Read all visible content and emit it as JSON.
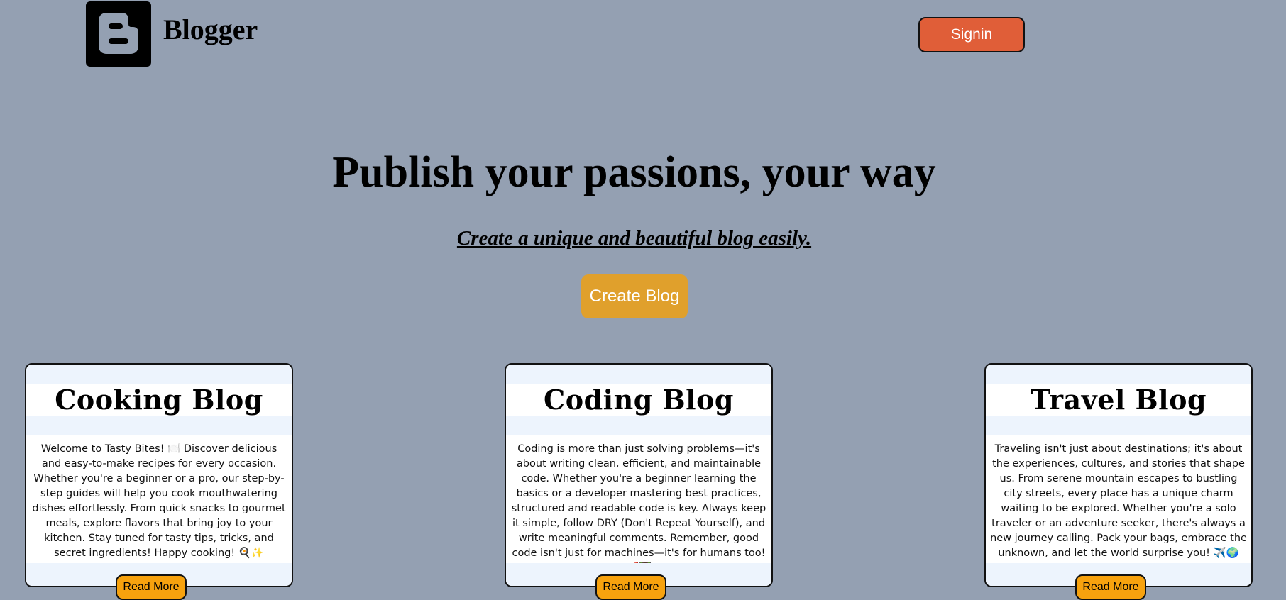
{
  "header": {
    "logo_icon": "blogger-b-icon",
    "brand": "Blogger",
    "signin_label": "Signin"
  },
  "hero": {
    "title": "Publish your passions, your way",
    "subtitle": "Create a unique and beautiful blog easily.",
    "create_label": "Create Blog"
  },
  "colors": {
    "background": "#94a0b2",
    "signin": "#e05e38",
    "create": "#e0a02c",
    "read_more": "#f7a20e",
    "card_band": "#edf4fd"
  },
  "cards": [
    {
      "title": "Cooking Blog",
      "text": "Welcome to Tasty Bites! 🍽️ Discover delicious and easy-to-make recipes for every occasion. Whether you're a beginner or a pro, our step-by-step guides will help you cook mouthwatering dishes effortlessly. From quick snacks to gourmet meals, explore flavors that bring joy to your kitchen. Stay tuned for tasty tips, tricks, and secret ingredients! Happy cooking! 🍳✨",
      "button": "Read More"
    },
    {
      "title": "Coding Blog",
      "text": "Coding is more than just solving problems—it's about writing clean, efficient, and maintainable code. Whether you're a beginner learning the basics or a developer mastering best practices, structured and readable code is key. Always keep it simple, follow DRY (Don't Repeat Yourself), and write meaningful comments. Remember, good code isn't just for machines—it's for humans too! 🚀👨‍💻",
      "button": "Read More"
    },
    {
      "title": "Travel Blog",
      "text": "Traveling isn't just about destinations; it's about the experiences, cultures, and stories that shape us. From serene mountain escapes to bustling city streets, every place has a unique charm waiting to be explored. Whether you're a solo traveler or an adventure seeker, there's always a new journey calling. Pack your bags, embrace the unknown, and let the world surprise you! ✈️🌍",
      "button": "Read More"
    }
  ]
}
